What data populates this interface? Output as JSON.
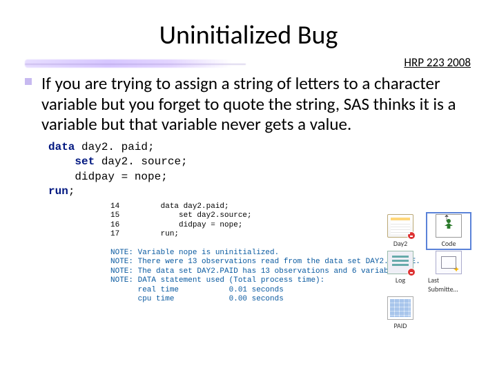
{
  "title": "Uninitialized Bug",
  "course": "HRP 223 2008",
  "bullet": "If you are trying to assign a string of letters to a character variable but you forget to quote the string, SAS thinks it is a variable but that variable never gets a value.",
  "code": {
    "kw_data": "data",
    "ds1": " day2. paid;",
    "kw_set": "    set",
    "ds2": " day2. source;",
    "assign": "    didpay = nope;",
    "kw_run": "run",
    "semi": ";"
  },
  "panel": {
    "day2": "Day2",
    "code": "Code",
    "log": "Log",
    "last": "Last Submitte…",
    "paid": "PAID"
  },
  "log": {
    "ln14": "14         data day2.paid;",
    "ln15": "15             set day2.source;",
    "ln16": "16             didpay = nope;",
    "ln17": "17         run;",
    "n1": "NOTE: Variable nope is uninitialized.",
    "n2": "NOTE: There were 13 observations read from the data set DAY2.SOURCE.",
    "n3": "NOTE: The data set DAY2.PAID has 13 observations and 6 variables.",
    "n4": "NOTE: DATA statement used (Total process time):",
    "n5": "      real time           0.01 seconds",
    "n6": "      cpu time            0.00 seconds"
  }
}
